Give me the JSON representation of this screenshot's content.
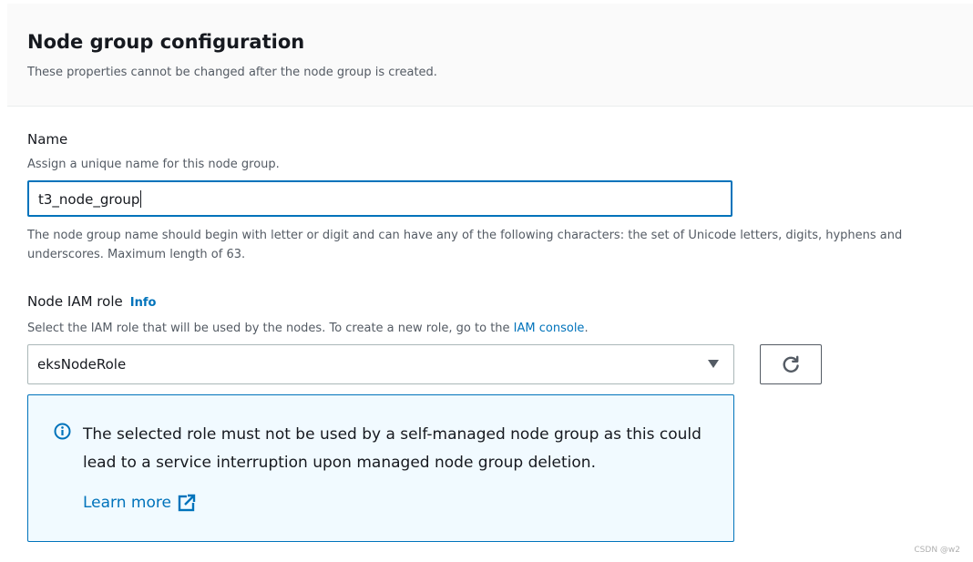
{
  "header": {
    "title": "Node group configuration",
    "description": "These properties cannot be changed after the node group is created."
  },
  "name_field": {
    "label": "Name",
    "description": "Assign a unique name for this node group.",
    "value": "t3_node_group",
    "constraint": "The node group name should begin with letter or digit and can have any of the following characters: the set of Unicode letters, digits, hyphens and underscores. Maximum length of 63."
  },
  "role_field": {
    "label": "Node IAM role",
    "info_label": "Info",
    "description_prefix": "Select the IAM role that will be used by the nodes. To create a new role, go to the ",
    "description_link": "IAM console",
    "description_suffix": ".",
    "selected_value": "eksNodeRole"
  },
  "alert": {
    "icon": "info-circle-icon",
    "message": "The selected role must not be used by a self-managed node group as this could lead to a service interruption upon managed node group deletion.",
    "learn_more": "Learn more"
  },
  "icons": {
    "refresh": "refresh-icon",
    "dropdown": "caret-down-icon",
    "external": "external-link-icon"
  },
  "colors": {
    "accent": "#0073bb",
    "alert_bg": "#f1faff",
    "header_bg": "#fafafa"
  },
  "watermark": "CSDN @w2"
}
